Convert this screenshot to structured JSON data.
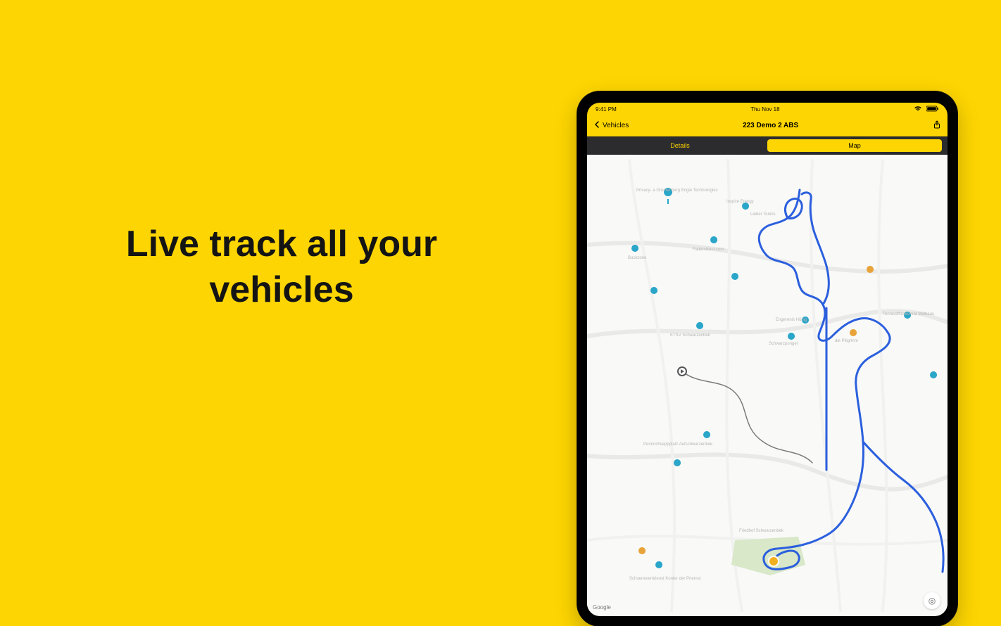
{
  "hero": {
    "headline": "Live track all your vehicles"
  },
  "statusbar": {
    "time": "9:41 PM",
    "date": "Thu Nov 18"
  },
  "navbar": {
    "back_label": "Vehicles",
    "title": "223 Demo 2 ABS",
    "right_icon": "share-icon"
  },
  "segment": {
    "left_label": "Details",
    "right_label": "Map",
    "active": "right"
  },
  "map": {
    "attribution": "Google",
    "locate_icon": "◎",
    "poi_labels": [
      "Privacy- a Grumenberg Engle Technologies",
      "Inspire Energy",
      "Lieber Tennis",
      "Buckzone",
      "Fademikeur.com",
      "ETSV Schwarzenbek",
      "Engerenis Hünig",
      "Schwarzpongel",
      "die Piligrinnt",
      "Pennrichseppplatz Aufschwarzenbek",
      "Friedhof Schwarzenbek",
      "Schoeneventrienst Konter der Priemst",
      "Tennisoffiziarenrat Willhaus"
    ]
  }
}
